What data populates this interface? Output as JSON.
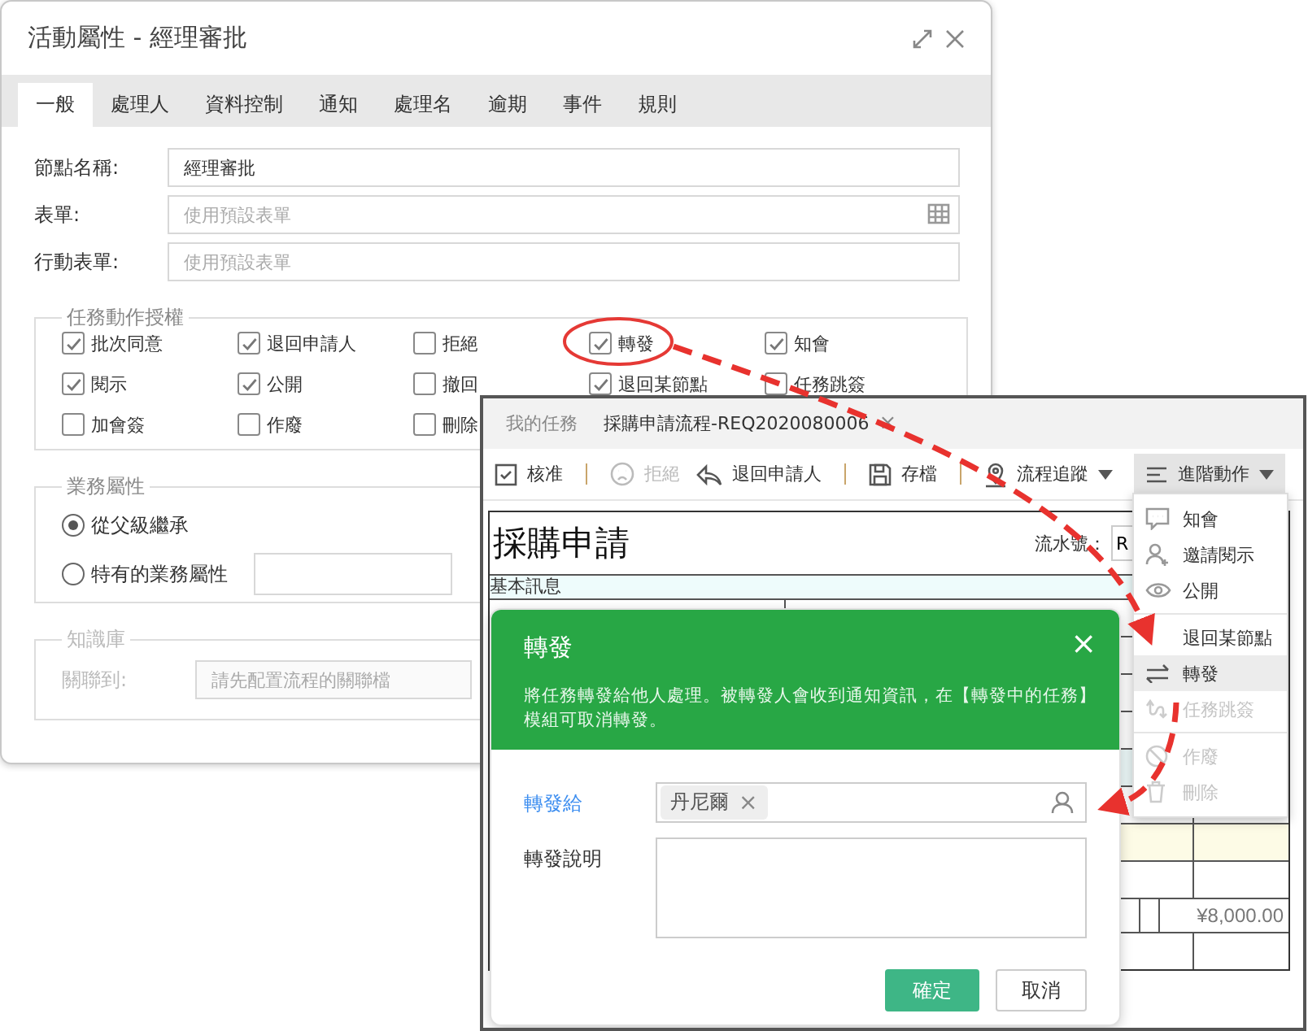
{
  "properties_dialog": {
    "title": "活動屬性 - 經理審批",
    "tabs": [
      {
        "label": "一般",
        "selected": true
      },
      {
        "label": "處理人",
        "selected": false
      },
      {
        "label": "資料控制",
        "selected": false
      },
      {
        "label": "通知",
        "selected": false
      },
      {
        "label": "處理名",
        "selected": false
      },
      {
        "label": "逾期",
        "selected": false
      },
      {
        "label": "事件",
        "selected": false
      },
      {
        "label": "規則",
        "selected": false
      }
    ],
    "fields": [
      {
        "label": "節點名稱:",
        "kind": "text",
        "value": "經理審批"
      },
      {
        "label": "表單:",
        "kind": "picker",
        "placeholder": "使用預設表單"
      },
      {
        "label": "行動表單:",
        "kind": "text",
        "placeholder": "使用預設表單"
      }
    ],
    "action_permissions": {
      "legend": "任務動作授權",
      "items": [
        {
          "label": "批次同意",
          "checked": true
        },
        {
          "label": "退回申請人",
          "checked": true
        },
        {
          "label": "拒絕",
          "checked": false
        },
        {
          "label": "轉發",
          "checked": true
        },
        {
          "label": "知會",
          "checked": true
        },
        {
          "label": "閱示",
          "checked": true
        },
        {
          "label": "公開",
          "checked": true
        },
        {
          "label": "撤回",
          "checked": false
        },
        {
          "label": "退回某節點",
          "checked": true
        },
        {
          "label": "任務跳簽",
          "checked": false
        },
        {
          "label": "加會簽",
          "checked": false
        },
        {
          "label": "作廢",
          "checked": false
        },
        {
          "label": "刪除",
          "checked": false
        }
      ]
    },
    "business_attributes": {
      "legend": "業務屬性",
      "options": [
        {
          "label": "從父級繼承",
          "selected": true
        },
        {
          "label": "特有的業務屬性",
          "selected": false
        }
      ]
    },
    "knowledge_base": {
      "legend": "知識庫",
      "label": "關聯到:",
      "placeholder": "請先配置流程的關聯檔",
      "disabled": true
    }
  },
  "task_window": {
    "tabs": [
      {
        "label": "我的任務",
        "selected": false,
        "closable": false
      },
      {
        "label": "採購申請流程-REQ2020080006",
        "selected": true,
        "closable": true
      }
    ],
    "close_glyph": "×",
    "toolbar": [
      {
        "kind": "approve",
        "label": "核准",
        "disabled": false,
        "dropdown": false,
        "pressed": false
      },
      {
        "kind": "separator"
      },
      {
        "kind": "reject",
        "label": "拒絕",
        "disabled": true,
        "dropdown": false,
        "pressed": false
      },
      {
        "kind": "return",
        "label": "退回申請人",
        "disabled": false,
        "dropdown": false,
        "pressed": false
      },
      {
        "kind": "separator"
      },
      {
        "kind": "save",
        "label": "存檔",
        "disabled": false,
        "dropdown": false,
        "pressed": false
      },
      {
        "kind": "separator"
      },
      {
        "kind": "track",
        "label": "流程追蹤",
        "disabled": false,
        "dropdown": true,
        "pressed": false
      },
      {
        "kind": "advanced",
        "label": "進階動作",
        "disabled": false,
        "dropdown": true,
        "pressed": true
      }
    ],
    "document": {
      "title": "採購申請",
      "serial_label": "流水號：",
      "serial_value": "R",
      "section": "基本訊息",
      "amount": "¥8,000.00"
    },
    "actions_menu": {
      "items": [
        {
          "kind": "comment",
          "label": "知會",
          "disabled": false,
          "selected": false
        },
        {
          "kind": "invite",
          "label": "邀請閱示",
          "disabled": false,
          "selected": false
        },
        {
          "kind": "view",
          "label": "公開",
          "disabled": false,
          "selected": false
        },
        {
          "kind": "divider"
        },
        {
          "kind": "plain",
          "label": "退回某節點",
          "disabled": false,
          "selected": false
        },
        {
          "kind": "forward",
          "label": "轉發",
          "disabled": false,
          "selected": true
        },
        {
          "kind": "jump",
          "label": "任務跳簽",
          "disabled": true,
          "selected": false
        },
        {
          "kind": "divider"
        },
        {
          "kind": "void",
          "label": "作廢",
          "disabled": true,
          "selected": false
        },
        {
          "kind": "delete",
          "label": "刪除",
          "disabled": true,
          "selected": false
        }
      ]
    },
    "forward_dialog": {
      "title": "轉發",
      "close_glyph": "×",
      "description": "將任務轉發給他人處理。被轉發人會收到通知資訊，在【轉發中的任務】模組可取消轉發。",
      "recipient_label": "轉發給",
      "recipients": [
        {
          "name": "丹尼爾",
          "remove_glyph": "×"
        }
      ],
      "note_label": "轉發說明",
      "buttons": [
        {
          "label": "確定",
          "primary": true
        },
        {
          "label": "取消",
          "primary": false
        }
      ]
    }
  }
}
